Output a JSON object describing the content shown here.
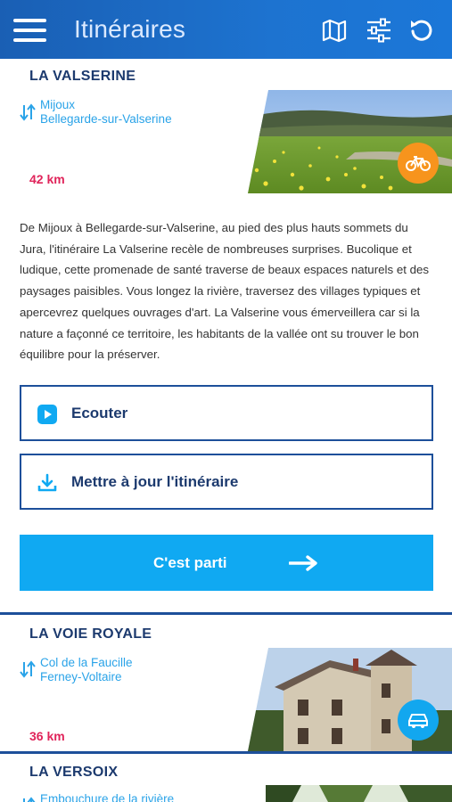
{
  "header": {
    "title": "Itinéraires",
    "menu_icon": "hamburger-menu-icon",
    "map_icon": "map-icon",
    "filter_icon": "sliders-filter-icon",
    "refresh_icon": "refresh-icon",
    "color": "#1d6cc8"
  },
  "routes": [
    {
      "title": "LA VALSERINE",
      "from": "Mijoux",
      "to": "Bellegarde-sur-Valserine",
      "distance": "42 km",
      "mode_icon": "bicycle-icon",
      "badge_color": "#f7941d",
      "description": "De Mijoux à Bellegarde-sur-Valserine, au pied des plus hauts sommets du Jura, l'itinéraire La Valserine recèle de nombreuses surprises. Bucolique et ludique, cette promenade de santé traverse de beaux espaces naturels et des paysages paisibles. Vous longez la rivière, traversez des villages typiques et apercevrez quelques ouvrages d'art. La Valserine vous émerveillera car si la nature a façonné ce territoire, les habitants de la vallée ont su trouver le bon équilibre pour la préserver.",
      "listen_label": "Ecouter",
      "update_label": "Mettre à jour l'itinéraire",
      "go_label": "C'est parti"
    },
    {
      "title": "LA VOIE ROYALE",
      "from": "Col de la Faucille",
      "to": "Ferney-Voltaire",
      "distance": "36 km",
      "mode_icon": "car-icon",
      "badge_color": "#12a7ef"
    },
    {
      "title": "LA VERSOIX",
      "from": "Embouchure de la rivière"
    }
  ],
  "colors": {
    "accent_blue": "#10a9f2",
    "navy": "#1c3a6e",
    "distance_red": "#e0245a",
    "link_blue": "#2aa3e8"
  }
}
